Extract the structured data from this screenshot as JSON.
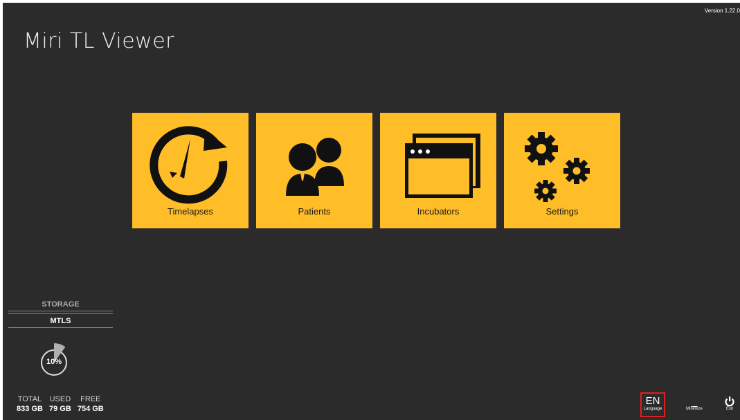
{
  "app": {
    "title": "Miri TL Viewer",
    "version": "Version 1.22.0",
    "accent_color": "#ffbe28",
    "background_color": "#2b2b2b"
  },
  "tiles": [
    {
      "label": "Timelapses",
      "icon": "clock-refresh-icon"
    },
    {
      "label": "Patients",
      "icon": "people-icon"
    },
    {
      "label": "Incubators",
      "icon": "windows-stack-icon"
    },
    {
      "label": "Settings",
      "icon": "gears-icon"
    }
  ],
  "storage": {
    "heading": "STORAGE",
    "drive": "MTLS",
    "used_fraction": 0.1,
    "used_percent_text": "10%",
    "total_label": "TOTAL",
    "total_value": "833 GB",
    "used_label": "USED",
    "used_value": "79 GB",
    "free_label": "FREE",
    "free_value": "754 GB"
  },
  "footer": {
    "language_code": "EN",
    "language_label": "Language",
    "minimize_glyph": "_",
    "minimize_label": "Minimize",
    "exit_label": "Exit",
    "exit_icon": "power-icon"
  }
}
